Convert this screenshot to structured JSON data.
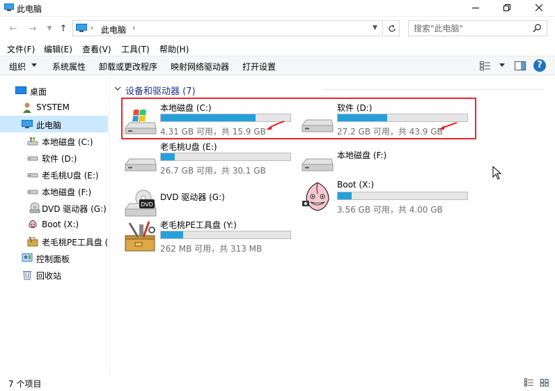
{
  "window": {
    "title": "此电脑"
  },
  "address": {
    "crumb": "此电脑",
    "search_placeholder": "搜索\"此电脑\""
  },
  "menu": [
    "文件(F)",
    "编辑(E)",
    "查看(V)",
    "工具(T)",
    "帮助(H)"
  ],
  "toolbar": {
    "organize": "组织",
    "system_properties": "系统属性",
    "uninstall": "卸载或更改程序",
    "map_drive": "映射网络驱动器",
    "open_settings": "打开设置",
    "help": "?"
  },
  "nav": {
    "desktop": "桌面",
    "system": "SYSTEM",
    "this_pc": "此电脑",
    "drive_c": "本地磁盘 (C:)",
    "drive_d": "软件 (D:)",
    "drive_e": "老毛桃U盘 (E:)",
    "drive_f": "本地磁盘 (F:)",
    "drive_g": "DVD 驱动器 (G:)",
    "drive_x": "Boot (X:)",
    "drive_y": "老毛桃PE工具盘 (",
    "control_panel": "控制面板",
    "recycle_bin": "回收站"
  },
  "group": {
    "title": "设备和驱动器 (7)"
  },
  "drives": {
    "c": {
      "name": "本地磁盘 (C:)",
      "info": "4.31 GB 可用，共 15.9 GB",
      "used_fraction": 0.73
    },
    "d": {
      "name": "软件 (D:)",
      "info": "27.2 GB 可用，共 43.9 GB",
      "used_fraction": 0.38
    },
    "e": {
      "name": "老毛桃U盘 (E:)",
      "info": "26.7 GB 可用，共 30.1 GB",
      "used_fraction": 0.11
    },
    "f": {
      "name": "本地磁盘 (F:)"
    },
    "g": {
      "name": "DVD 驱动器 (G:)",
      "dvd_label": "DVD"
    },
    "x": {
      "name": "Boot (X:)",
      "info": "3.56 GB 可用，共 4.00 GB",
      "used_fraction": 0.11
    },
    "y": {
      "name": "老毛桃PE工具盘 (Y:)",
      "info": "262 MB 可用，共 313 MB",
      "used_fraction": 0.17
    }
  },
  "status": {
    "count": "7 个项目"
  },
  "colors": {
    "bar_fill": "#26a0da",
    "highlight": "#e8262b",
    "selected": "#cce8ff"
  }
}
